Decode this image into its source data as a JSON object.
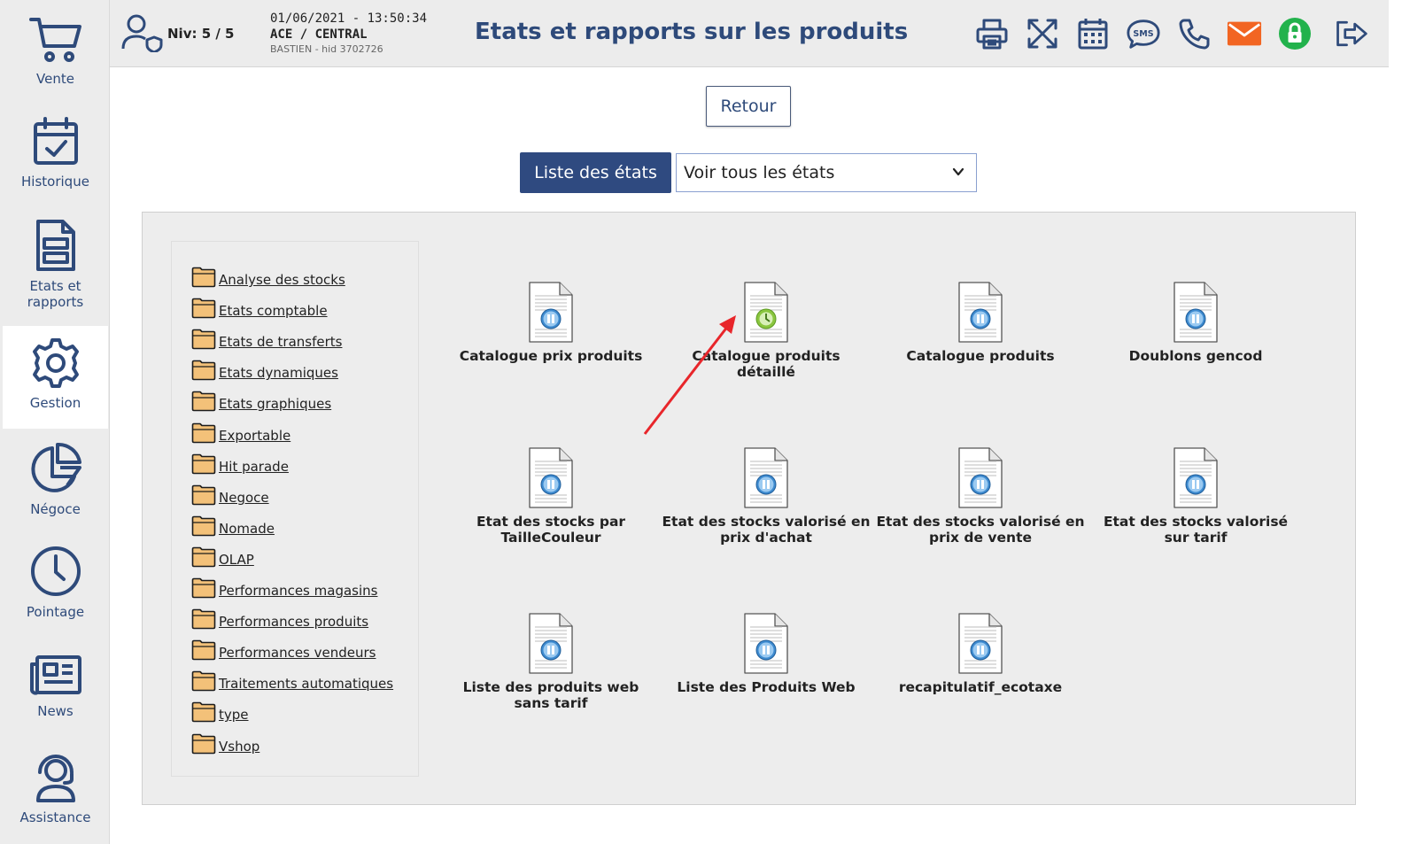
{
  "sidebar": {
    "items": [
      {
        "label": "Vente",
        "icon": "shopping-cart-icon"
      },
      {
        "label": "Historique",
        "icon": "calendar-check-icon"
      },
      {
        "label": "Etats et rapports",
        "icon": "report-document-icon"
      },
      {
        "label": "Gestion",
        "icon": "gear-icon",
        "active": true
      },
      {
        "label": "Négoce",
        "icon": "pie-chart-icon"
      },
      {
        "label": "Pointage",
        "icon": "clock-icon"
      },
      {
        "label": "News",
        "icon": "newspaper-icon"
      },
      {
        "label": "Assistance",
        "icon": "headset-icon"
      }
    ]
  },
  "header": {
    "level": "Niv: 5 / 5",
    "datetime": "01/06/2021 - 13:50:34",
    "company": "ACE / CENTRAL",
    "user": "BASTIEN - hid 3702726",
    "title": "Etats et rapports sur les produits",
    "tools": [
      "print-icon",
      "fullscreen-icon",
      "calendar-icon",
      "sms-icon",
      "phone-icon",
      "mail-icon",
      "lock-icon",
      "logout-icon"
    ]
  },
  "main": {
    "back_label": "Retour",
    "list_button_label": "Liste des états",
    "filter_select": {
      "value": "Voir tous les états"
    }
  },
  "folders": [
    "Analyse des stocks",
    "Etats comptable",
    "Etats de transferts",
    "Etats dynamiques",
    "Etats graphiques",
    "Exportable",
    "Hit parade",
    "Negoce",
    "Nomade",
    "OLAP",
    "Performances magasins",
    "Performances produits",
    "Performances vendeurs",
    "Traitements automatiques",
    "type",
    "Vshop"
  ],
  "reports": [
    {
      "line1": "Catalogue prix produits",
      "line2": "",
      "icon": "report-pause-icon"
    },
    {
      "line1": "Catalogue produits",
      "line2": "détaillé",
      "icon": "report-clock-icon"
    },
    {
      "line1": "Catalogue produits",
      "line2": "",
      "icon": "report-pause-icon"
    },
    {
      "line1": "Doublons gencod",
      "line2": "",
      "icon": "report-pause-icon"
    },
    {
      "line1": "Etat des stocks par",
      "line2": "TailleCouleur",
      "icon": "report-pause-icon"
    },
    {
      "line1": "Etat des stocks valorisé en",
      "line2": "prix d'achat",
      "icon": "report-pause-icon"
    },
    {
      "line1": "Etat des stocks valorisé en",
      "line2": "prix de vente",
      "icon": "report-pause-icon"
    },
    {
      "line1": "Etat des stocks valorisé",
      "line2": "sur tarif",
      "icon": "report-pause-icon"
    },
    {
      "line1": "Liste des produits web",
      "line2": "sans tarif",
      "icon": "report-pause-icon"
    },
    {
      "line1": "Liste des Produits Web",
      "line2": "",
      "icon": "report-pause-icon"
    },
    {
      "line1": "recapitulatif_ecotaxe",
      "line2": "",
      "icon": "report-pause-icon"
    }
  ],
  "colors": {
    "accent": "#2e4a7a",
    "button": "#2f4a80",
    "annotation_arrow": "#e8262b",
    "mail": "#f26522",
    "lock": "#22b24c"
  }
}
